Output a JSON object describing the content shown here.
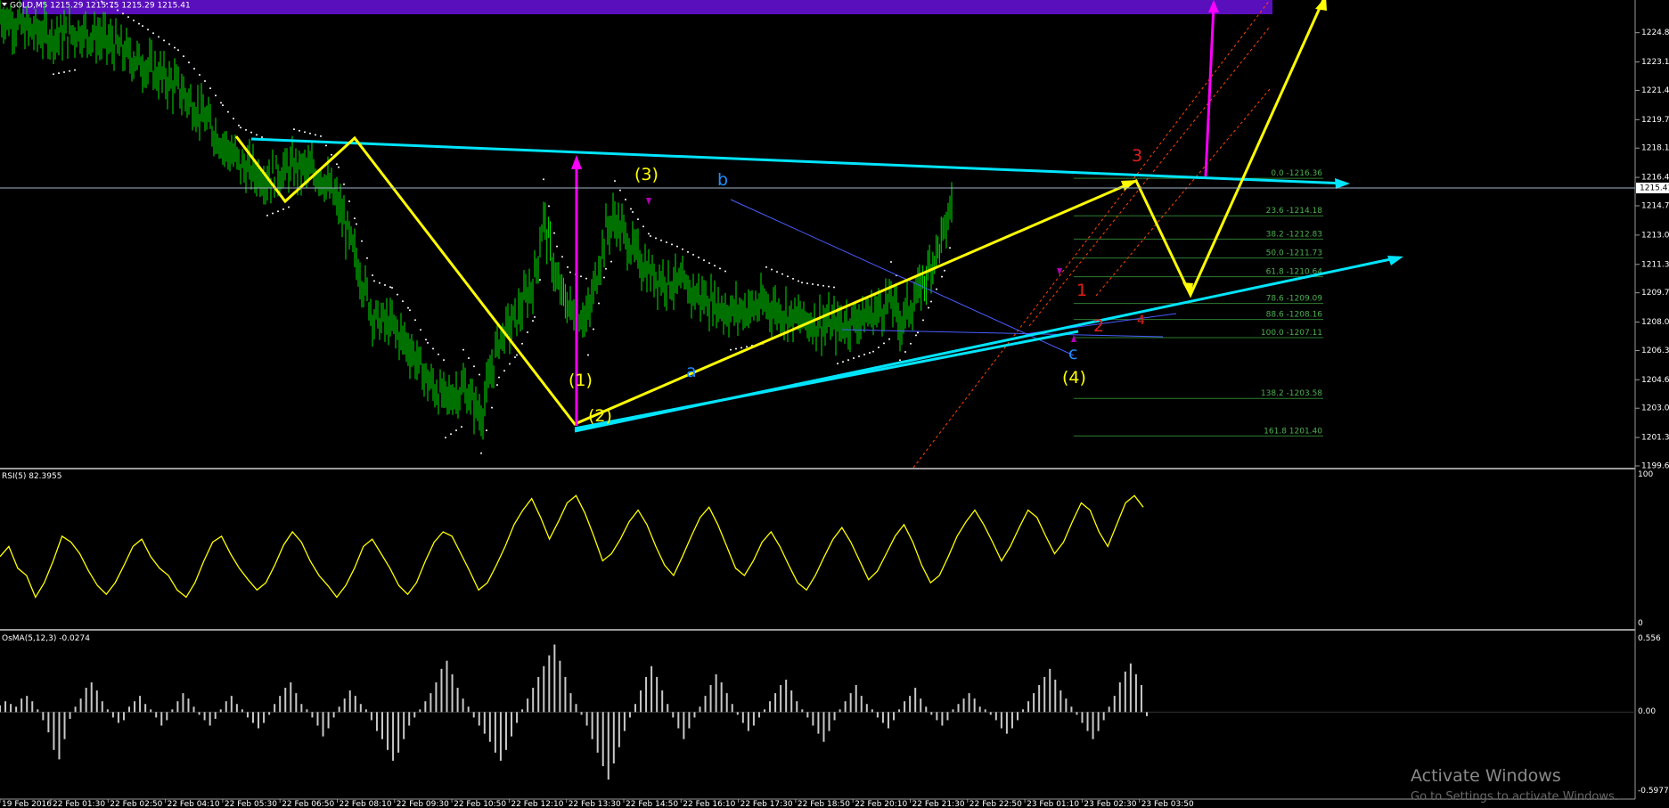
{
  "instrument_header": "GOLD,M5  1215.29 1215.75 1215.29 1215.41",
  "last_price": "1215.41",
  "colors": {
    "background": "#000000",
    "candle": "#00e000",
    "rsi": "#ffff00",
    "osma": "#c8c8c8",
    "trend_line": "#00e5ff",
    "wave_path": "#ffff00",
    "target_arrow": "#ff00ff",
    "channel": "#ff4500",
    "fib": "#2e7d32",
    "header_band": "#5a0fbd"
  },
  "chart_data": [
    {
      "type": "line",
      "title": "GOLD,M5",
      "ylim": [
        1199.66,
        1226.5
      ],
      "y_ticks": [
        "1224.81",
        "1223.11",
        "1221.46",
        "1219.76",
        "1218.11",
        "1216.41",
        "1214.76",
        "1213.06",
        "1211.36",
        "1209.71",
        "1208.01",
        "1206.36",
        "1204.66",
        "1203.01",
        "1201.31",
        "1199.66"
      ],
      "x_ticks": [
        "19 Feb 2016",
        "22 Feb 01:30",
        "22 Feb 02:50",
        "22 Feb 04:10",
        "22 Feb 05:30",
        "22 Feb 06:50",
        "22 Feb 08:10",
        "22 Feb 09:30",
        "22 Feb 10:50",
        "22 Feb 12:10",
        "22 Feb 13:30",
        "22 Feb 14:50",
        "22 Feb 16:10",
        "22 Feb 17:30",
        "22 Feb 18:50",
        "22 Feb 20:10",
        "22 Feb 21:30",
        "22 Feb 22:50",
        "23 Feb 01:10",
        "23 Feb 02:30",
        "23 Feb 03:50"
      ],
      "price_path": [
        [
          0,
          1225.8
        ],
        [
          30,
          1225.0
        ],
        [
          60,
          1224.6
        ],
        [
          90,
          1224.9
        ],
        [
          120,
          1224.3
        ],
        [
          160,
          1223.0
        ],
        [
          200,
          1221.6
        ],
        [
          230,
          1219.8
        ],
        [
          250,
          1218.4
        ],
        [
          270,
          1217.1
        ],
        [
          300,
          1216.4
        ],
        [
          330,
          1217.0
        ],
        [
          360,
          1216.6
        ],
        [
          380,
          1214.8
        ],
        [
          400,
          1211.5
        ],
        [
          420,
          1208.2
        ],
        [
          440,
          1207.8
        ],
        [
          460,
          1206.5
        ],
        [
          480,
          1204.6
        ],
        [
          500,
          1203.5
        ],
        [
          520,
          1204.2
        ],
        [
          540,
          1202.6
        ],
        [
          560,
          1207.0
        ],
        [
          580,
          1208.3
        ],
        [
          600,
          1210.5
        ],
        [
          610,
          1214.1
        ],
        [
          625,
          1210.2
        ],
        [
          640,
          1208.7
        ],
        [
          660,
          1208.3
        ],
        [
          680,
          1213.3
        ],
        [
          690,
          1214.0
        ],
        [
          710,
          1212.2
        ],
        [
          730,
          1210.8
        ],
        [
          760,
          1210.2
        ],
        [
          790,
          1209.4
        ],
        [
          820,
          1208.6
        ],
        [
          860,
          1209.0
        ],
        [
          900,
          1208.1
        ],
        [
          940,
          1207.8
        ],
        [
          980,
          1208.5
        ],
        [
          1000,
          1209.3
        ],
        [
          1010,
          1208.0
        ],
        [
          1030,
          1209.6
        ],
        [
          1045,
          1211.4
        ],
        [
          1060,
          1213.2
        ],
        [
          1070,
          1215.4
        ]
      ],
      "wave_labels": {
        "yellow": [
          "(1)",
          "(2)",
          "(3)",
          "(4)"
        ],
        "blue": [
          "a",
          "b",
          "c"
        ],
        "red": [
          "1",
          "2",
          "3",
          "4"
        ]
      },
      "fib_levels": [
        {
          "label": "0.0 -1216.36",
          "price": 1216.36
        },
        {
          "label": "23.6 -1214.18",
          "price": 1214.18
        },
        {
          "label": "38.2 -1212.83",
          "price": 1212.83
        },
        {
          "label": "50.0 -1211.73",
          "price": 1211.73
        },
        {
          "label": "61.8 -1210.64",
          "price": 1210.64
        },
        {
          "label": "78.6 -1209.09",
          "price": 1209.09
        },
        {
          "label": "88.6 -1208.16",
          "price": 1208.16
        },
        {
          "label": "100.0 -1207.11",
          "price": 1207.11
        },
        {
          "label": "138.2 -1203.58",
          "price": 1203.58
        },
        {
          "label": "161.8 1201.40",
          "price": 1201.4
        }
      ]
    },
    {
      "type": "line",
      "title": "RSI(5) 82.3955",
      "ylim": [
        0,
        100
      ],
      "y_ticks": [
        "100",
        "0"
      ],
      "values": [
        48,
        55,
        40,
        35,
        20,
        30,
        45,
        62,
        58,
        50,
        38,
        28,
        22,
        30,
        42,
        55,
        60,
        48,
        40,
        35,
        25,
        20,
        30,
        45,
        58,
        62,
        50,
        40,
        32,
        25,
        30,
        42,
        56,
        65,
        58,
        45,
        35,
        28,
        20,
        28,
        40,
        55,
        60,
        50,
        40,
        28,
        22,
        30,
        45,
        58,
        65,
        62,
        50,
        38,
        25,
        30,
        42,
        55,
        70,
        80,
        88,
        75,
        60,
        72,
        85,
        90,
        78,
        62,
        45,
        50,
        60,
        72,
        80,
        70,
        55,
        42,
        35,
        48,
        62,
        75,
        82,
        70,
        55,
        40,
        35,
        45,
        58,
        65,
        55,
        42,
        30,
        25,
        35,
        48,
        60,
        68,
        58,
        45,
        32,
        38,
        50,
        62,
        70,
        58,
        42,
        30,
        35,
        48,
        62,
        72,
        80,
        70,
        58,
        45,
        55,
        68,
        80,
        75,
        62,
        50,
        58,
        72,
        85,
        80,
        65,
        55,
        70,
        85,
        90,
        82
      ]
    },
    {
      "type": "bar",
      "title": "OsMA(5,12,3) -0.0274",
      "ylim": [
        -0.5977,
        0.556
      ],
      "y_ticks": [
        "0.556",
        "0.00",
        "-0.5977"
      ],
      "values": [
        0.05,
        0.08,
        0.06,
        0.04,
        0.1,
        0.12,
        0.08,
        0.02,
        -0.06,
        -0.15,
        -0.28,
        -0.35,
        -0.2,
        -0.05,
        0.04,
        0.1,
        0.18,
        0.22,
        0.16,
        0.08,
        0.02,
        -0.04,
        -0.08,
        -0.06,
        0.04,
        0.08,
        0.12,
        0.06,
        0.02,
        -0.04,
        -0.1,
        -0.06,
        0.02,
        0.08,
        0.14,
        0.1,
        0.04,
        -0.02,
        -0.06,
        -0.1,
        -0.05,
        0.02,
        0.08,
        0.12,
        0.06,
        0.02,
        -0.04,
        -0.08,
        -0.12,
        -0.08,
        -0.02,
        0.06,
        0.12,
        0.18,
        0.22,
        0.14,
        0.06,
        0.02,
        -0.04,
        -0.1,
        -0.18,
        -0.12,
        -0.04,
        0.04,
        0.1,
        0.16,
        0.12,
        0.06,
        0.02,
        -0.06,
        -0.14,
        -0.2,
        -0.28,
        -0.36,
        -0.3,
        -0.2,
        -0.1,
        -0.04,
        0.02,
        0.08,
        0.14,
        0.22,
        0.32,
        0.38,
        0.28,
        0.18,
        0.1,
        0.04,
        -0.04,
        -0.1,
        -0.16,
        -0.22,
        -0.3,
        -0.36,
        -0.28,
        -0.18,
        -0.08,
        0.02,
        0.1,
        0.18,
        0.26,
        0.34,
        0.42,
        0.5,
        0.38,
        0.26,
        0.14,
        0.06,
        -0.02,
        -0.1,
        -0.2,
        -0.3,
        -0.4,
        -0.5,
        -0.38,
        -0.26,
        -0.14,
        -0.04,
        0.06,
        0.16,
        0.26,
        0.34,
        0.26,
        0.16,
        0.06,
        -0.04,
        -0.12,
        -0.2,
        -0.12,
        -0.04,
        0.04,
        0.12,
        0.2,
        0.28,
        0.22,
        0.14,
        0.06,
        -0.02,
        -0.08,
        -0.14,
        -0.1,
        -0.04,
        0.02,
        0.08,
        0.14,
        0.2,
        0.24,
        0.16,
        0.08,
        0.02,
        -0.04,
        -0.1,
        -0.16,
        -0.22,
        -0.14,
        -0.06,
        0.02,
        0.08,
        0.14,
        0.2,
        0.12,
        0.06,
        0.02,
        -0.04,
        -0.08,
        -0.12,
        -0.06,
        0.02,
        0.08,
        0.12,
        0.18,
        0.1,
        0.04,
        -0.02,
        -0.06,
        -0.1,
        -0.06,
        0.02,
        0.06,
        0.1,
        0.14,
        0.1,
        0.04,
        0.02,
        -0.02,
        -0.06,
        -0.12,
        -0.16,
        -0.12,
        -0.06,
        0.02,
        0.08,
        0.14,
        0.2,
        0.26,
        0.32,
        0.24,
        0.16,
        0.1,
        0.04,
        -0.02,
        -0.08,
        -0.14,
        -0.2,
        -0.14,
        -0.06,
        0.04,
        0.12,
        0.22,
        0.3,
        0.36,
        0.28,
        0.2,
        -0.03
      ]
    }
  ],
  "watermark": {
    "line1": "Activate Windows",
    "line2": "Go to Settings to activate Windows."
  }
}
